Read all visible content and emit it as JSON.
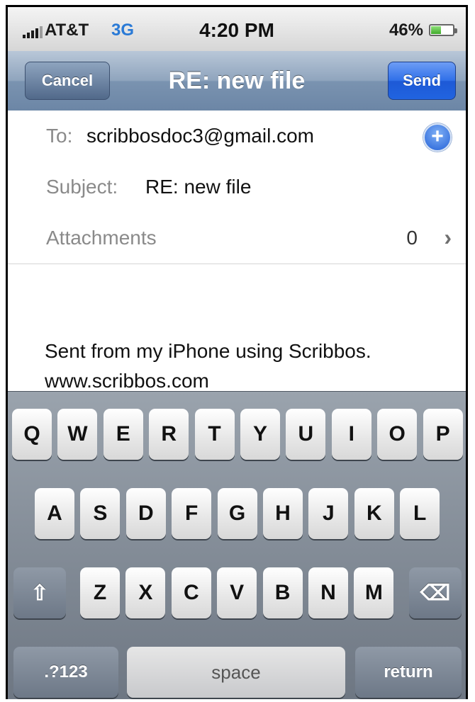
{
  "status_bar": {
    "carrier": "AT&T",
    "network": "3G",
    "time": "4:20 PM",
    "battery": "46%",
    "battery_level": 0.46,
    "signal_icon": "signal-bars-icon",
    "battery_icon": "battery-icon"
  },
  "nav": {
    "cancel_label": "Cancel",
    "title": "RE: new file",
    "send_label": "Send"
  },
  "compose": {
    "to_label": "To:",
    "to_value": "scribbosdoc3@gmail.com",
    "add_contact_icon": "+",
    "subject_label": "Subject:",
    "subject_value": "RE: new file",
    "attachments_label": "Attachments",
    "attachments_count": "0",
    "attachments_chevron": "›"
  },
  "body": {
    "line1": "Sent from my iPhone using Scribbos.",
    "line2": "www.scribbos.com"
  },
  "keyboard": {
    "row1": [
      "Q",
      "W",
      "E",
      "R",
      "T",
      "Y",
      "U",
      "I",
      "O",
      "P"
    ],
    "row2": [
      "A",
      "S",
      "D",
      "F",
      "G",
      "H",
      "J",
      "K",
      "L"
    ],
    "row3": [
      "Z",
      "X",
      "C",
      "V",
      "B",
      "N",
      "M"
    ],
    "shift_icon": "⇧",
    "delete_icon": "⌫",
    "numbers_label": ".?123",
    "space_label": "space",
    "return_label": "return"
  },
  "colors": {
    "nav_bar": "#7a93b0",
    "send_button": "#2164e0",
    "keyboard_bg": "#7d8691"
  }
}
